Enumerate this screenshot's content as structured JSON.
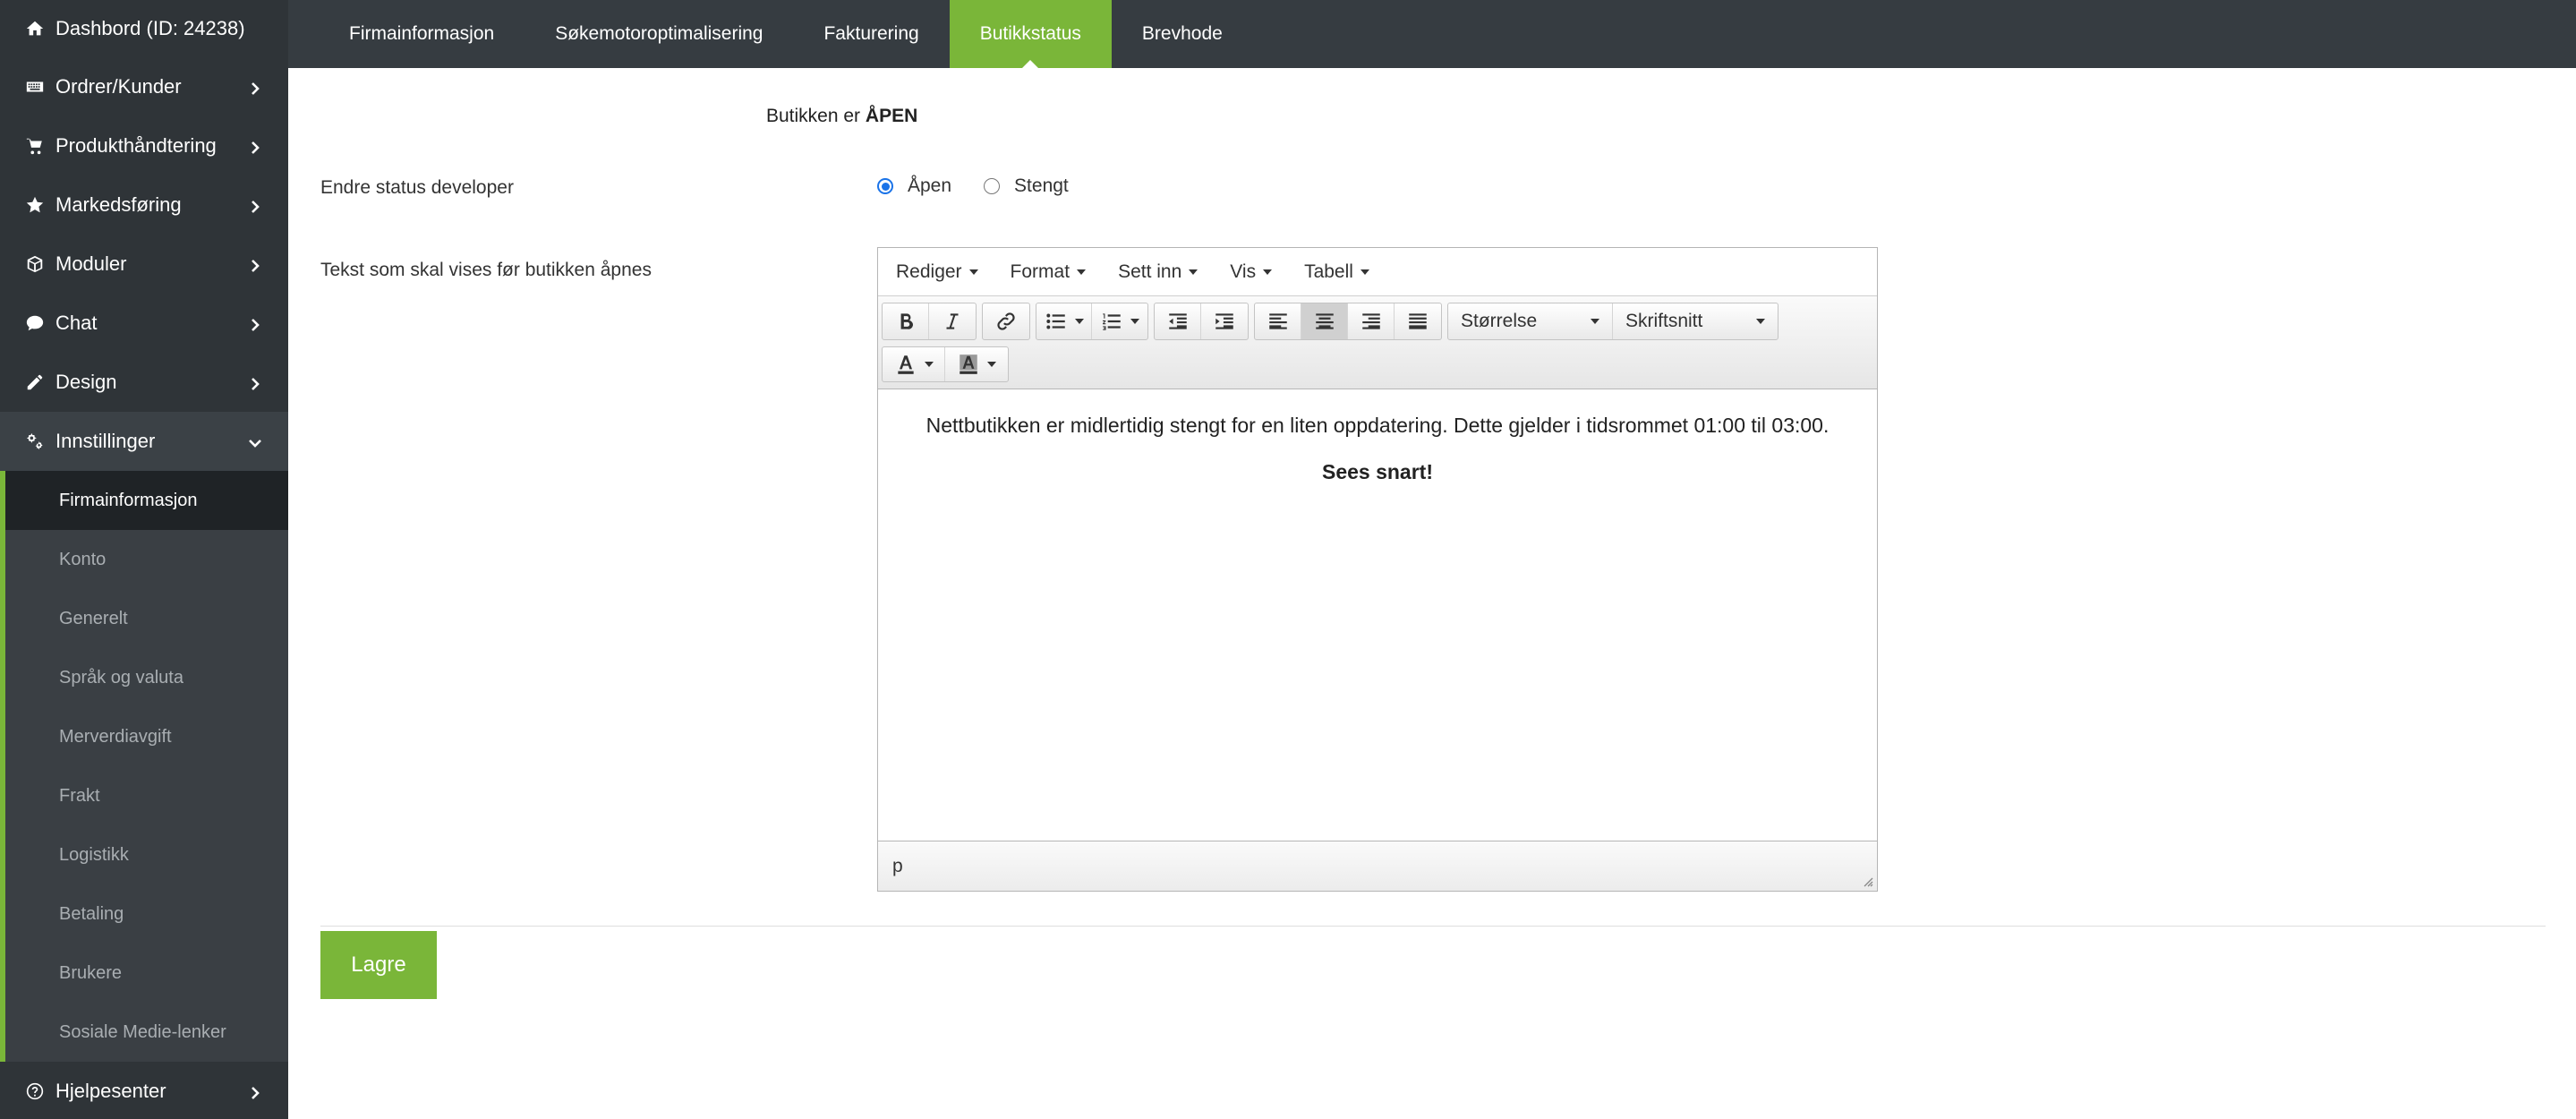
{
  "sidebar": {
    "items": [
      {
        "label": "Dashbord (ID: 24238)",
        "icon": "home-icon"
      },
      {
        "label": "Ordrer/Kunder",
        "icon": "keyboard-icon"
      },
      {
        "label": "Produkthåndtering",
        "icon": "cart-icon"
      },
      {
        "label": "Markedsføring",
        "icon": "star-icon"
      },
      {
        "label": "Moduler",
        "icon": "cube-icon"
      },
      {
        "label": "Chat",
        "icon": "chat-icon"
      },
      {
        "label": "Design",
        "icon": "pencil-icon"
      },
      {
        "label": "Innstillinger",
        "icon": "gears-icon"
      }
    ],
    "submenu": [
      "Firmainformasjon",
      "Konto",
      "Generelt",
      "Språk og valuta",
      "Merverdiavgift",
      "Frakt",
      "Logistikk",
      "Betaling",
      "Brukere",
      "Sosiale Medie-lenker"
    ],
    "help": {
      "label": "Hjelpesenter",
      "icon": "help-icon"
    }
  },
  "tabs": [
    "Firmainformasjon",
    "Søkemotoroptimalisering",
    "Fakturering",
    "Butikkstatus",
    "Brevhode"
  ],
  "active_tab": "Butikkstatus",
  "main": {
    "status_prefix": "Butikken er",
    "status_value": "ÅPEN",
    "change_status_label": "Endre status developer",
    "radio_open": "Åpen",
    "radio_closed": "Stengt",
    "text_label": "Tekst som skal vises før butikken åpnes"
  },
  "editor": {
    "menus": [
      "Rediger",
      "Format",
      "Sett inn",
      "Vis",
      "Tabell"
    ],
    "size_select": "Størrelse",
    "font_select": "Skriftsnitt",
    "paragraph1": "Nettbutikken er midlertidig stengt for en liten oppdatering. Dette gjelder i tidsrommet 01:00 til 03:00.",
    "paragraph2": "Sees snart!",
    "path": "p"
  },
  "save_label": "Lagre",
  "colors": {
    "accent": "#7ab639",
    "sidebar": "#2f3438",
    "topbar": "#363c41"
  }
}
